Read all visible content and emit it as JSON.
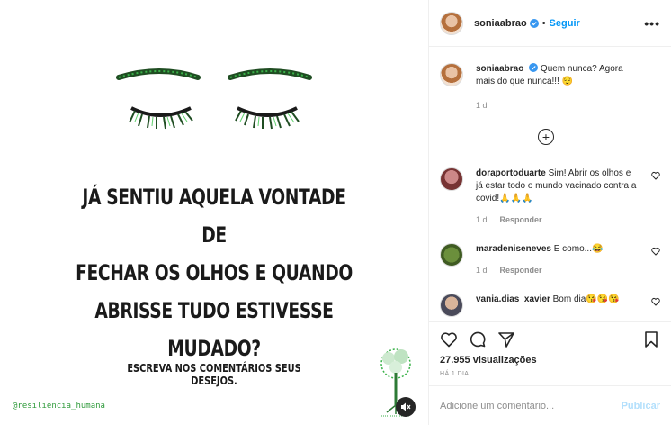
{
  "post": {
    "image": {
      "headline_lines": [
        "JÁ SENTIU AQUELA VONTADE DE",
        "FECHAR OS OLHOS E QUANDO",
        "ABRISSE TUDO ESTIVESSE",
        "MUDADO?"
      ],
      "subline": "ESCREVA NOS COMENTÁRIOS SEUS DESEJOS.",
      "handle": "@resiliencia_humana",
      "accent_color": "#3bb24a"
    },
    "header": {
      "username": "soniaabrao",
      "follow_label": "Seguir",
      "more_label": "•••"
    },
    "caption": {
      "username": "soniaabrao",
      "text": "Quem nunca? Agora mais do que nunca!!! 😌",
      "time": "1 d"
    },
    "load_more_label": "+",
    "comments": [
      {
        "username": "doraportoduarte",
        "text": "Sim! Abrir os olhos e já estar todo o mundo vacinado contra a covid!🙏🙏🙏",
        "time": "1 d",
        "reply": "Responder"
      },
      {
        "username": "maradeniseneves",
        "text": "E como...😂",
        "time": "1 d",
        "reply": "Responder"
      },
      {
        "username": "vania.dias_xavier",
        "text": "Bom dia😘😘😘",
        "time": "",
        "reply": ""
      }
    ],
    "stats": {
      "views": "27.955 visualizações",
      "posted_ago": "HÁ 1 DIA"
    },
    "add_comment": {
      "placeholder": "Adicione um comentário...",
      "publish_label": "Publicar"
    },
    "colors": {
      "link_blue": "#0095f6",
      "publish_disabled": "#b2dffc",
      "muted_text": "#8e8e8e"
    }
  }
}
